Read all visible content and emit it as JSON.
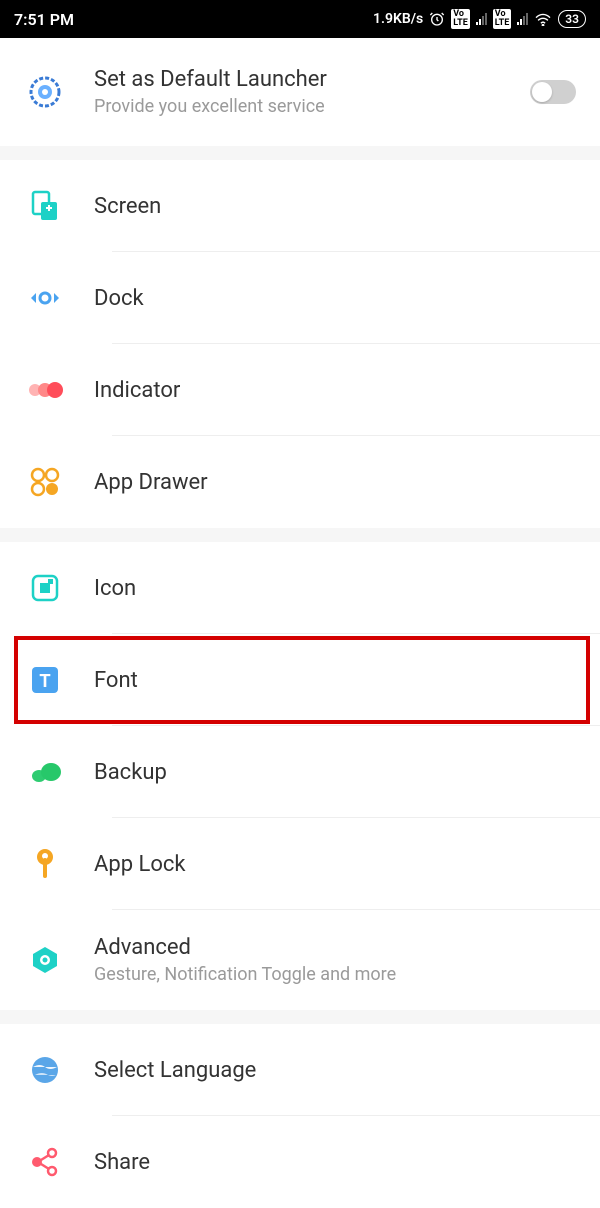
{
  "status": {
    "time": "7:51 PM",
    "netspeed": "1.9KB/s",
    "battery": "33"
  },
  "launcher": {
    "title": "Set as Default Launcher",
    "subtitle": "Provide you excellent service"
  },
  "group1": {
    "screen": "Screen",
    "dock": "Dock",
    "indicator": "Indicator",
    "appdrawer": "App Drawer"
  },
  "group2": {
    "icon": "Icon",
    "font": "Font",
    "backup": "Backup",
    "applock": "App Lock",
    "advanced": "Advanced",
    "advanced_sub": "Gesture, Notification Toggle and more"
  },
  "group3": {
    "language": "Select Language",
    "share": "Share"
  }
}
